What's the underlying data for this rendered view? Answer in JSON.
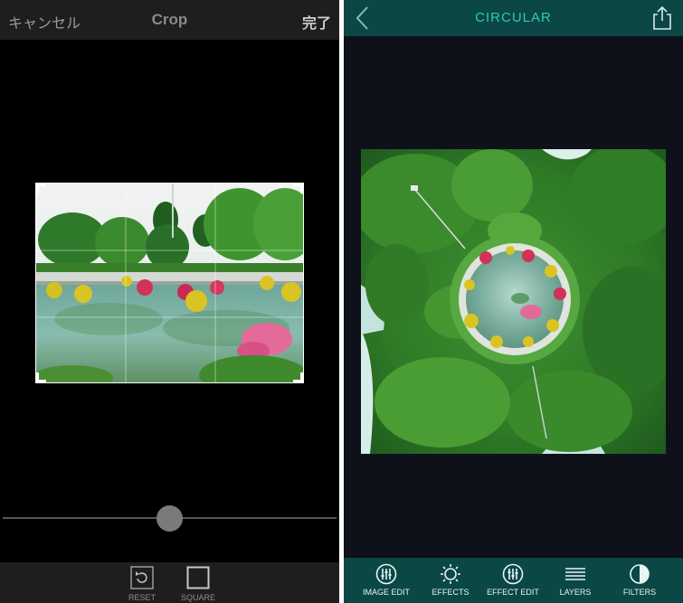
{
  "crop_screen": {
    "header": {
      "cancel_label": "キャンセル",
      "title": "Crop",
      "done_label": "完了"
    },
    "slider": {
      "value_fraction": 0.5
    },
    "footer": {
      "reset_label": "RESET",
      "square_label": "SQUARE"
    },
    "icons": {
      "reset": "rotate-reset-icon",
      "square": "square-aspect-icon"
    }
  },
  "circular_screen": {
    "header": {
      "title": "CIRCULAR",
      "back_icon": "chevron-left-icon",
      "share_icon": "share-icon"
    },
    "toolbar": {
      "items": [
        {
          "label": "IMAGE EDIT",
          "icon": "sliders-circle-icon"
        },
        {
          "label": "EFFECTS",
          "icon": "sun-burst-icon"
        },
        {
          "label": "EFFECT EDIT",
          "icon": "sliders-circle-icon"
        },
        {
          "label": "LAYERS",
          "icon": "layers-lines-icon"
        },
        {
          "label": "FILTERS",
          "icon": "half-circle-icon"
        }
      ]
    }
  },
  "colors": {
    "crop_bg": "#000000",
    "crop_bar": "#1e1e1e",
    "circular_bar": "#0b4744",
    "circular_bg": "#0e1119",
    "circular_title": "#2ec9b8"
  }
}
